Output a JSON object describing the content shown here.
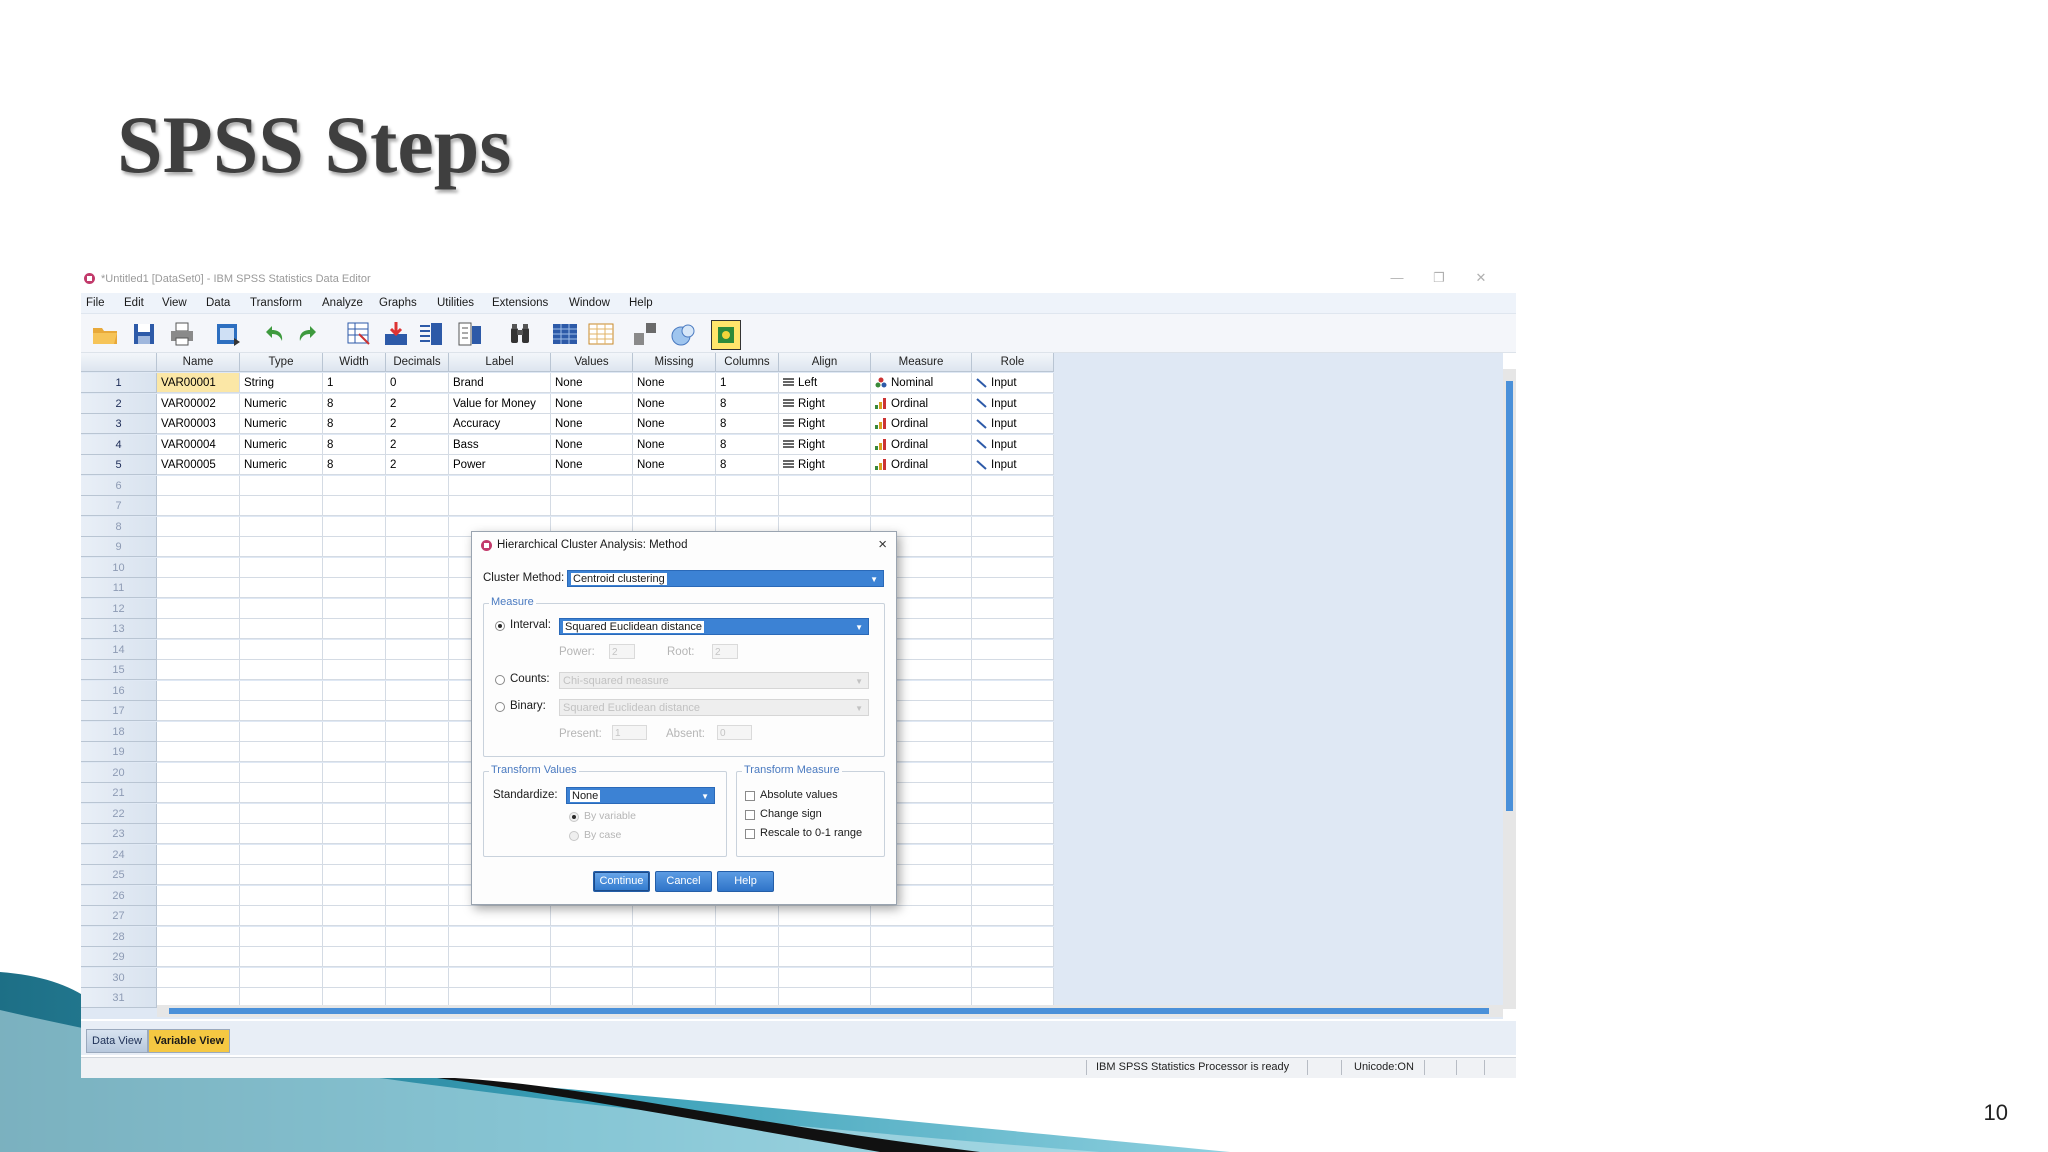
{
  "slide": {
    "title": "SPSS Steps",
    "page_number": "10"
  },
  "window": {
    "title": "*Untitled1 [DataSet0] - IBM SPSS Statistics Data Editor",
    "controls": [
      "—",
      "❐",
      "✕"
    ]
  },
  "menu": [
    "File",
    "Edit",
    "View",
    "Data",
    "Transform",
    "Analyze",
    "Graphs",
    "Utilities",
    "Extensions",
    "Window",
    "Help"
  ],
  "toolbar_icons": [
    "open-icon",
    "save-icon",
    "print-icon",
    "dialog-recall-icon",
    "undo-icon",
    "redo-icon",
    "goto-case-icon",
    "goto-variable-icon",
    "variables-icon",
    "run-descriptives-icon",
    "find-icon",
    "insert-cases-icon",
    "insert-variable-icon",
    "split-file-icon",
    "weight-cases-icon",
    "select-cases-icon",
    "value-labels-icon",
    "use-sets-icon"
  ],
  "grid": {
    "columns": [
      "Name",
      "Type",
      "Width",
      "Decimals",
      "Label",
      "Values",
      "Missing",
      "Columns",
      "Align",
      "Measure",
      "Role"
    ],
    "rows": [
      [
        "VAR00001",
        "String",
        "1",
        "0",
        "Brand",
        "None",
        "None",
        "1",
        "Left",
        "Nominal",
        "Input"
      ],
      [
        "VAR00002",
        "Numeric",
        "8",
        "2",
        "Value for Money",
        "None",
        "None",
        "8",
        "Right",
        "Ordinal",
        "Input"
      ],
      [
        "VAR00003",
        "Numeric",
        "8",
        "2",
        "Accuracy",
        "None",
        "None",
        "8",
        "Right",
        "Ordinal",
        "Input"
      ],
      [
        "VAR00004",
        "Numeric",
        "8",
        "2",
        "Bass",
        "None",
        "None",
        "8",
        "Right",
        "Ordinal",
        "Input"
      ],
      [
        "VAR00005",
        "Numeric",
        "8",
        "2",
        "Power",
        "None",
        "None",
        "8",
        "Right",
        "Ordinal",
        "Input"
      ]
    ],
    "row_numbers": [
      "1",
      "2",
      "3",
      "4",
      "5",
      "6",
      "7",
      "8",
      "9",
      "10",
      "11",
      "12",
      "13",
      "14",
      "15",
      "16",
      "17",
      "18",
      "19",
      "20",
      "21",
      "22",
      "23",
      "24",
      "25",
      "26",
      "27",
      "28",
      "29",
      "30",
      "31"
    ]
  },
  "tabs": {
    "data_view": "Data View",
    "variable_view": "Variable View"
  },
  "status": {
    "processor": "IBM SPSS Statistics Processor is ready",
    "unicode": "Unicode:ON"
  },
  "dialog": {
    "title": "Hierarchical Cluster Analysis: Method",
    "close": "×",
    "cluster_method_label": "Cluster Method:",
    "cluster_method_value": "Centroid clustering",
    "measure": {
      "legend": "Measure",
      "interval_label": "Interval:",
      "interval_value": "Squared Euclidean distance",
      "power_label": "Power:",
      "power_value": "2",
      "root_label": "Root:",
      "root_value": "2",
      "counts_label": "Counts:",
      "counts_value": "Chi-squared measure",
      "binary_label": "Binary:",
      "binary_value": "Squared Euclidean distance",
      "present_label": "Present:",
      "present_value": "1",
      "absent_label": "Absent:",
      "absent_value": "0"
    },
    "transform_values": {
      "legend": "Transform Values",
      "standardize_label": "Standardize:",
      "standardize_value": "None",
      "by_variable": "By variable",
      "by_case": "By case"
    },
    "transform_measure": {
      "legend": "Transform Measure",
      "absolute": "Absolute values",
      "change_sign": "Change sign",
      "rescale": "Rescale to 0-1 range"
    },
    "buttons": {
      "continue": "Continue",
      "cancel": "Cancel",
      "help": "Help"
    }
  }
}
